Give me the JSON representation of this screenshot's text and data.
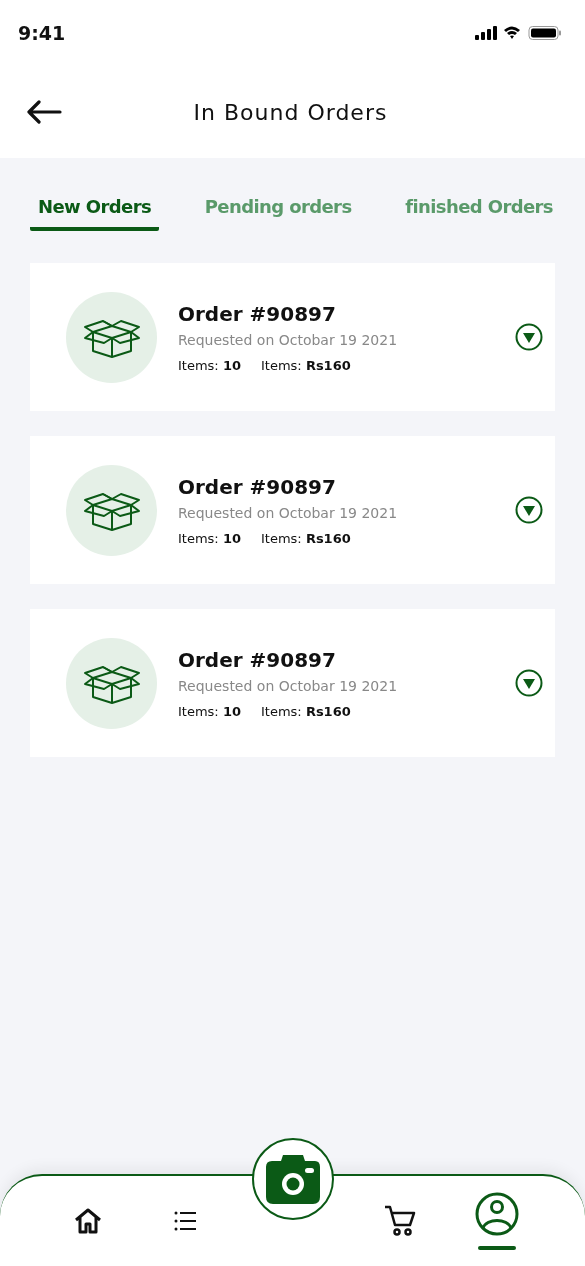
{
  "status_bar": {
    "time": "9:41"
  },
  "header": {
    "title": "In Bound Orders"
  },
  "tabs": [
    {
      "label": "New Orders",
      "selected": true
    },
    {
      "label": "Pending orders",
      "selected": false
    },
    {
      "label": "finished Orders",
      "selected": false
    }
  ],
  "orders": [
    {
      "title": "Order #90897",
      "date": "Requested on Octobar 19 2021",
      "items": "Items: **10**",
      "amount": "Items: **Rs160**"
    },
    {
      "title": "Order #90897",
      "date": "Requested on Octobar 19 2021",
      "items": "Items: **10**",
      "amount": "Items: **Rs160**"
    },
    {
      "title": "Order #90897",
      "date": "Requested on Octobar 19 2021",
      "items": "Items: **10**",
      "amount": "Items: **Rs160**"
    }
  ],
  "bottom_nav": [
    {
      "kind": "home",
      "selected": false
    },
    {
      "kind": "list",
      "selected": false
    },
    {
      "kind": "camera",
      "selected": false
    },
    {
      "kind": "cart",
      "selected": false
    },
    {
      "kind": "profile",
      "selected": true
    }
  ]
}
